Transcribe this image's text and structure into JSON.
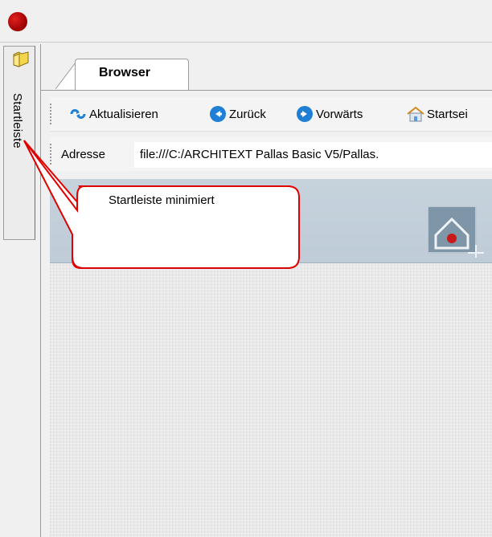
{
  "sidebar": {
    "label": "Startleiste",
    "icon": "folder-icon"
  },
  "tabs": [
    {
      "label": "Browser"
    }
  ],
  "toolbar": {
    "refresh_label": "Aktualisieren",
    "back_label": "Zurück",
    "forward_label": "Vorwärts",
    "home_label": "Startsei"
  },
  "address": {
    "label": "Adresse",
    "value": "file:///C:/ARCHITEXT Pallas Basic V5/Pallas."
  },
  "callout": {
    "text": "Startleiste minimiert"
  },
  "colors": {
    "app_dot": "#c00000",
    "banner": "#c3d0db",
    "callout_border": "#e00000"
  }
}
